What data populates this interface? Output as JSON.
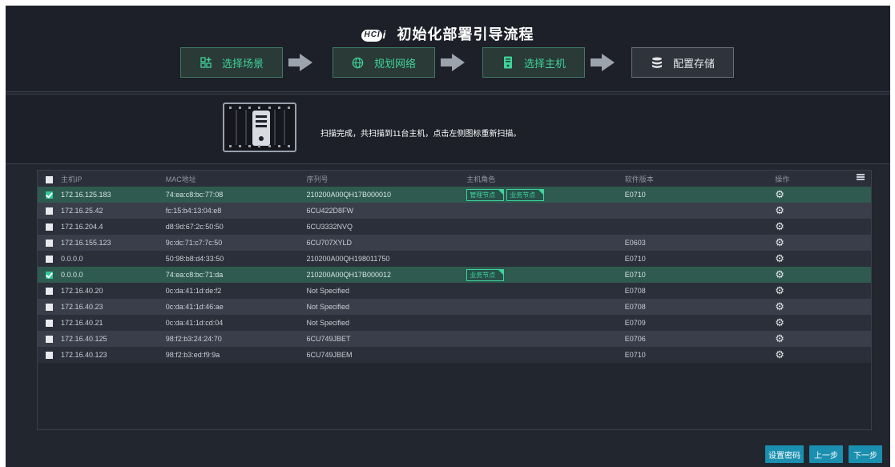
{
  "header": {
    "logo_text": "HCI",
    "title": "初始化部署引导流程",
    "steps": [
      {
        "label": "选择场景",
        "icon": "grid-add-icon"
      },
      {
        "label": "规划网络",
        "icon": "globe-icon"
      },
      {
        "label": "选择主机",
        "icon": "server-icon"
      },
      {
        "label": "配置存储",
        "icon": "database-icon"
      }
    ]
  },
  "scan": {
    "message": "扫描完成，共扫描到11台主机，点击左侧图标重新扫描。"
  },
  "table": {
    "columns": [
      "主机IP",
      "MAC地址",
      "序列号",
      "主机角色",
      "软件版本",
      "操作"
    ],
    "rows": [
      {
        "ip": "172.16.125.183",
        "mac": "74:ea:c8:bc:77:08",
        "serial": "210200A00QH17B000010",
        "roles": [
          "管理节点",
          "业务节点"
        ],
        "version": "E0710",
        "checked": true
      },
      {
        "ip": "172.16.25.42",
        "mac": "fc:15:b4:13:04:e8",
        "serial": "6CU422D8FW",
        "roles": [],
        "version": "",
        "checked": false
      },
      {
        "ip": "172.16.204.4",
        "mac": "d8:9d:67:2c:50:50",
        "serial": "6CU3332NVQ",
        "roles": [],
        "version": "",
        "checked": false
      },
      {
        "ip": "172.16.155.123",
        "mac": "9c:dc:71:c7:7c:50",
        "serial": "6CU707XYLD",
        "roles": [],
        "version": "E0603",
        "checked": false
      },
      {
        "ip": "0.0.0.0",
        "mac": "50:98:b8:d4:33:50",
        "serial": "210200A00QH198011750",
        "roles": [],
        "version": "E0710",
        "checked": false
      },
      {
        "ip": "0.0.0.0",
        "mac": "74:ea:c8:bc:71:da",
        "serial": "210200A00QH17B000012",
        "roles": [
          "业务节点"
        ],
        "version": "E0710",
        "checked": true
      },
      {
        "ip": "172.16.40.20",
        "mac": "0c:da:41:1d:de:f2",
        "serial": "Not Specified",
        "roles": [],
        "version": "E0708",
        "checked": false
      },
      {
        "ip": "172.16.40.23",
        "mac": "0c:da:41:1d:46:ae",
        "serial": "Not Specified",
        "roles": [],
        "version": "E0708",
        "checked": false
      },
      {
        "ip": "172.16.40.21",
        "mac": "0c:da:41:1d:cd:04",
        "serial": "Not Specified",
        "roles": [],
        "version": "E0709",
        "checked": false
      },
      {
        "ip": "172.16.40.125",
        "mac": "98:f2:b3:24:24:70",
        "serial": "6CU749JBET",
        "roles": [],
        "version": "E0706",
        "checked": false
      },
      {
        "ip": "172.16.40.123",
        "mac": "98:f2:b3:ed:f9:9a",
        "serial": "6CU749JBEM",
        "roles": [],
        "version": "E0710",
        "checked": false
      }
    ]
  },
  "footer": {
    "set_password": "设置密码",
    "prev": "上一步",
    "next": "下一步"
  },
  "colors": {
    "accent_green": "#3fd29a",
    "button_blue": "#1a8fb0",
    "selected_row": "#2e5a50",
    "background": "#22262f"
  }
}
